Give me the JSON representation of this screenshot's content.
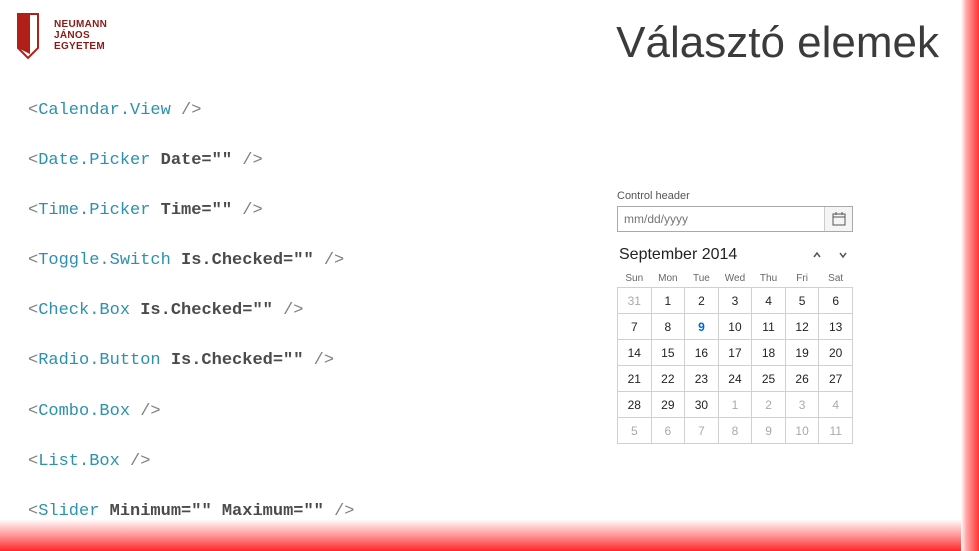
{
  "logo": {
    "line1": "NEUMANN",
    "line2": "JÁNOS",
    "line3": "EGYETEM"
  },
  "title": "Választó elemek",
  "code": {
    "lines": [
      {
        "tag": "Calendar.View",
        "attrs": []
      },
      {
        "tag": "Date.Picker",
        "attrs": [
          "Date=\"\""
        ]
      },
      {
        "tag": "Time.Picker",
        "attrs": [
          "Time=\"\""
        ]
      },
      {
        "tag": "Toggle.Switch",
        "attrs": [
          "Is.Checked=\"\""
        ]
      },
      {
        "tag": "Check.Box",
        "attrs": [
          "Is.Checked=\"\""
        ]
      },
      {
        "tag": "Radio.Button",
        "attrs": [
          "Is.Checked=\"\""
        ]
      },
      {
        "tag": "Combo.Box",
        "attrs": []
      },
      {
        "tag": "List.Box",
        "attrs": []
      },
      {
        "tag": "Slider",
        "attrs": [
          "Minimum=\"\"",
          "Maximum=\"\""
        ]
      }
    ]
  },
  "calendar": {
    "control_header": "Control header",
    "placeholder": "mm/dd/yyyy",
    "month": "September 2014",
    "dow": [
      "Sun",
      "Mon",
      "Tue",
      "Wed",
      "Thu",
      "Fri",
      "Sat"
    ],
    "today": 9,
    "weeks": [
      [
        {
          "d": 31,
          "o": true
        },
        {
          "d": 1
        },
        {
          "d": 2
        },
        {
          "d": 3
        },
        {
          "d": 4
        },
        {
          "d": 5
        },
        {
          "d": 6
        }
      ],
      [
        {
          "d": 7
        },
        {
          "d": 8
        },
        {
          "d": 9,
          "t": true
        },
        {
          "d": 10
        },
        {
          "d": 11
        },
        {
          "d": 12
        },
        {
          "d": 13
        }
      ],
      [
        {
          "d": 14
        },
        {
          "d": 15
        },
        {
          "d": 16
        },
        {
          "d": 17
        },
        {
          "d": 18
        },
        {
          "d": 19
        },
        {
          "d": 20
        }
      ],
      [
        {
          "d": 21
        },
        {
          "d": 22
        },
        {
          "d": 23
        },
        {
          "d": 24
        },
        {
          "d": 25
        },
        {
          "d": 26
        },
        {
          "d": 27
        }
      ],
      [
        {
          "d": 28
        },
        {
          "d": 29
        },
        {
          "d": 30
        },
        {
          "d": 1,
          "o": true
        },
        {
          "d": 2,
          "o": true
        },
        {
          "d": 3,
          "o": true
        },
        {
          "d": 4,
          "o": true
        }
      ],
      [
        {
          "d": 5,
          "o": true
        },
        {
          "d": 6,
          "o": true
        },
        {
          "d": 7,
          "o": true
        },
        {
          "d": 8,
          "o": true
        },
        {
          "d": 9,
          "o": true
        },
        {
          "d": 10,
          "o": true
        },
        {
          "d": 11,
          "o": true
        }
      ]
    ]
  }
}
